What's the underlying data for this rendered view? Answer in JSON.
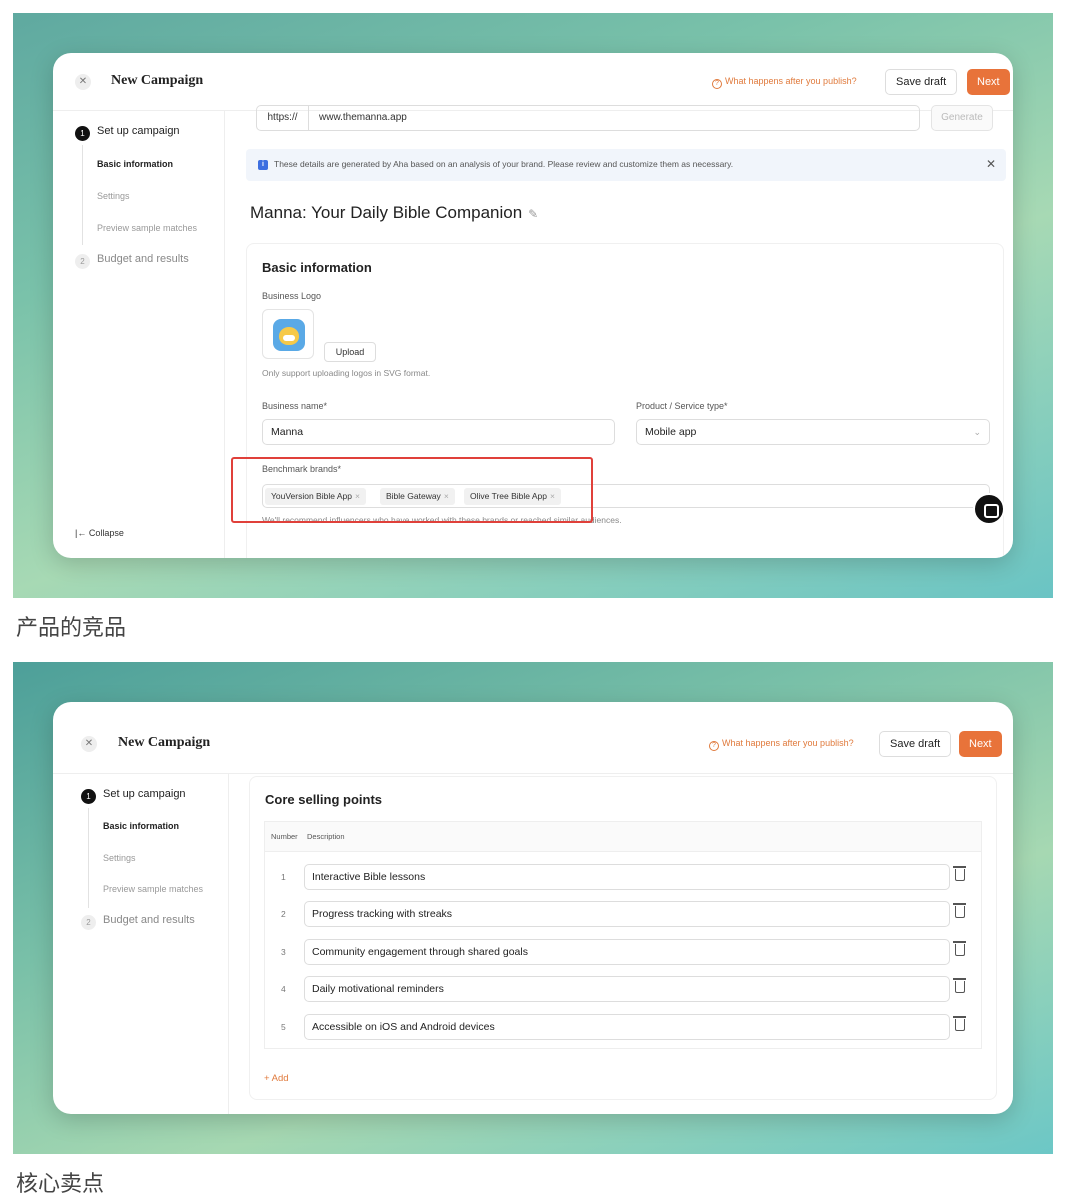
{
  "colors": {
    "accent": "#e8733a",
    "highlight": "#e0403a"
  },
  "header": {
    "title": "New Campaign",
    "publish_link": "What happens after you publish?",
    "save_draft": "Save draft",
    "next": "Next"
  },
  "sidebar": {
    "step1": {
      "num": "1",
      "label": "Set up campaign"
    },
    "substeps": [
      "Basic information",
      "Settings",
      "Preview sample matches"
    ],
    "step2": {
      "num": "2",
      "label": "Budget and results"
    },
    "collapse": "Collapse"
  },
  "screen1": {
    "url_prefix": "https://",
    "url_value": "www.themanna.app",
    "generate": "Generate",
    "notice": "These details are generated by Aha based on an analysis of your brand. Please review and customize them as necessary.",
    "page_title": "Manna: Your Daily Bible Companion",
    "section_title": "Basic information",
    "logo_label": "Business Logo",
    "upload": "Upload",
    "logo_help": "Only support uploading logos in SVG format.",
    "business_name_label": "Business name*",
    "business_name_value": "Manna",
    "product_type_label": "Product / Service type*",
    "product_type_value": "Mobile app",
    "benchmark_label": "Benchmark brands*",
    "benchmark_tags": [
      "YouVersion Bible App",
      "Bible Gateway",
      "Olive Tree Bible App"
    ],
    "benchmark_help": "We'll recommend influencers who have worked with these brands or reached similar audiences.",
    "caption": "产品的竞品"
  },
  "screen2": {
    "section_title": "Core selling points",
    "col_number": "Number",
    "col_description": "Description",
    "rows": [
      {
        "num": "1",
        "text": "Interactive Bible lessons"
      },
      {
        "num": "2",
        "text": "Progress tracking with streaks"
      },
      {
        "num": "3",
        "text": "Community engagement through shared goals"
      },
      {
        "num": "4",
        "text": "Daily motivational reminders"
      },
      {
        "num": "5",
        "text": "Accessible on iOS and Android devices"
      }
    ],
    "add": "+ Add",
    "caption": "核心卖点"
  }
}
